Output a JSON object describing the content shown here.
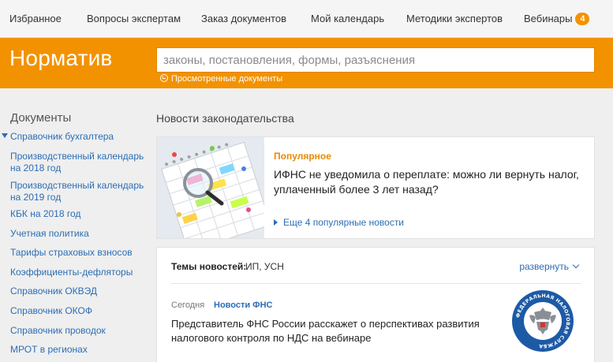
{
  "topnav": {
    "items": [
      "Избранное",
      "Вопросы экспертам",
      "Заказ  документов",
      "Мой календарь",
      "Методики экспертов",
      "Вебинары"
    ],
    "webinars_badge": "4"
  },
  "header": {
    "logo": "Норматив",
    "search_placeholder": "законы, постановления, формы, разъяснения",
    "viewed_link": "Просмотренные документы"
  },
  "sidebar": {
    "title": "Документы",
    "items": [
      "Справочник бухгалтера",
      "Производственный календарь на 2018 год",
      "Производственный календарь на 2019 год",
      "КБК на 2018 год",
      "Учетная политика",
      "Тарифы страховых взносов",
      "Коэффициенты-дефляторы",
      "Справочник ОКВЭД",
      "Справочник ОКОФ",
      "Справочник проводок",
      "МРОТ в регионах"
    ]
  },
  "main": {
    "title": "Новости законодательства",
    "popular": {
      "label": "Популярное",
      "headline": "ИФНС не уведомила о переплате: можно ли вернуть налог, уплаченный более 3 лет назад?",
      "more_link": "Еще 4 популярные новости"
    },
    "topics": {
      "label": "Темы новостей:",
      "value": "ИП, УСН",
      "expand": "развернуть"
    },
    "news": {
      "date": "Сегодня",
      "category": "Новости ФНС",
      "headline": "Представитель ФНС России расскажет о перспективах развития налогового контроля по НДС на вебинаре",
      "emblem_text": "ФЕДЕРАЛЬНАЯ НАЛОГОВАЯ СЛУЖБА"
    }
  },
  "colors": {
    "brand": "#f39200",
    "link": "#2c6db5",
    "emblem_blue": "#1d5aa6"
  }
}
